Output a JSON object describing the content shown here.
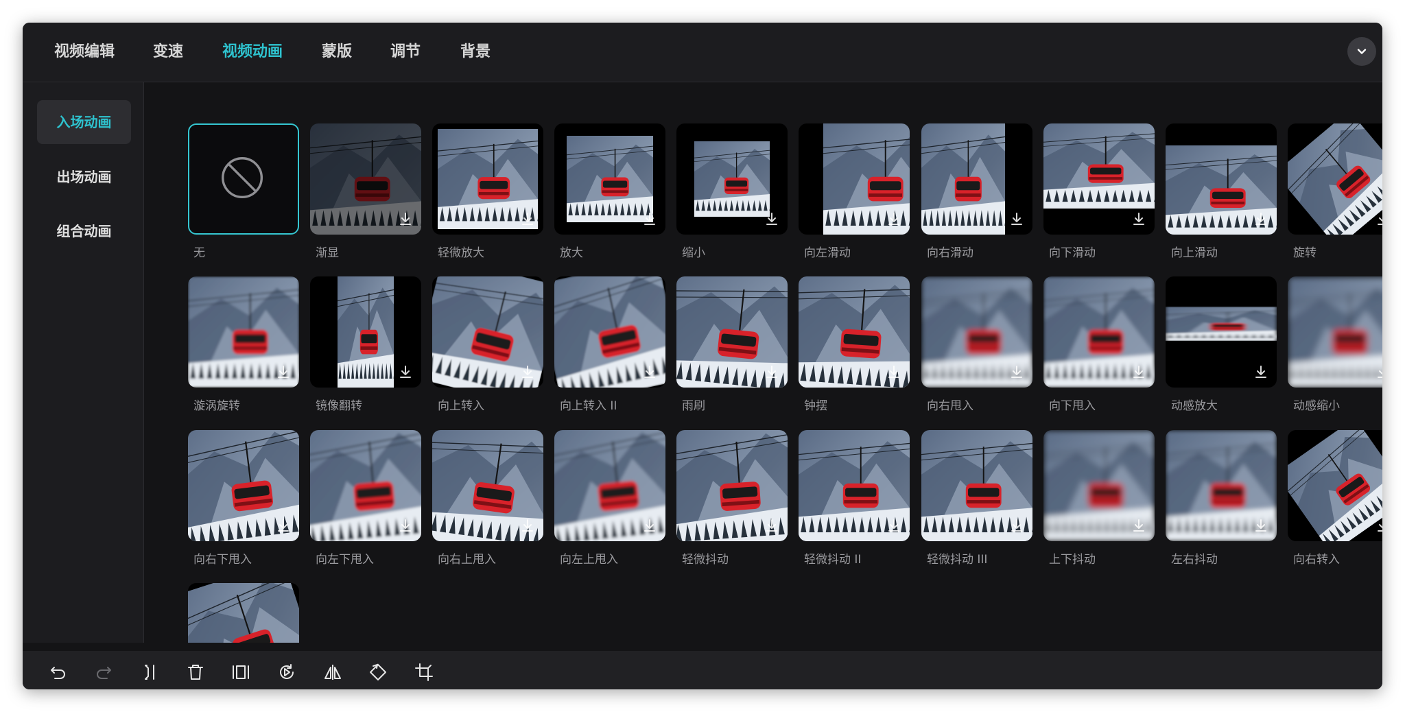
{
  "tabs": [
    {
      "label": "视频编辑",
      "active": false
    },
    {
      "label": "变速",
      "active": false
    },
    {
      "label": "视频动画",
      "active": true
    },
    {
      "label": "蒙版",
      "active": false
    },
    {
      "label": "调节",
      "active": false
    },
    {
      "label": "背景",
      "active": false
    }
  ],
  "sidebar": {
    "items": [
      {
        "label": "入场动画",
        "active": true
      },
      {
        "label": "出场动画",
        "active": false
      },
      {
        "label": "组合动画",
        "active": false
      }
    ]
  },
  "animations": [
    {
      "label": "无",
      "selected": true
    },
    {
      "label": "渐显"
    },
    {
      "label": "轻微放大"
    },
    {
      "label": "放大"
    },
    {
      "label": "缩小"
    },
    {
      "label": "向左滑动"
    },
    {
      "label": "向右滑动"
    },
    {
      "label": "向下滑动"
    },
    {
      "label": "向上滑动"
    },
    {
      "label": "旋转"
    },
    {
      "label": "漩涡旋转"
    },
    {
      "label": "镜像翻转"
    },
    {
      "label": "向上转入"
    },
    {
      "label": "向上转入 II"
    },
    {
      "label": "雨刷"
    },
    {
      "label": "钟摆"
    },
    {
      "label": "向右甩入"
    },
    {
      "label": "向下甩入"
    },
    {
      "label": "动感放大"
    },
    {
      "label": "动感缩小"
    },
    {
      "label": "向右下甩入"
    },
    {
      "label": "向左下甩入"
    },
    {
      "label": "向右上甩入"
    },
    {
      "label": "向左上甩入"
    },
    {
      "label": "轻微抖动"
    },
    {
      "label": "轻微抖动 II"
    },
    {
      "label": "轻微抖动 III"
    },
    {
      "label": "上下抖动"
    },
    {
      "label": "左右抖动"
    },
    {
      "label": "向右转入"
    },
    {
      "label": ""
    }
  ],
  "toolbar": {
    "icons": [
      "undo-icon",
      "redo-icon",
      "split-icon",
      "delete-icon",
      "freeze-frame-icon",
      "reverse-play-icon",
      "mirror-icon",
      "rotate-icon",
      "crop-icon"
    ]
  },
  "colors": {
    "accent": "#2ec3cf",
    "background": "#1b1b1d",
    "gondola": "#d8222a"
  },
  "icons": {
    "none": "no-entry-icon",
    "download": "download-icon",
    "collapse": "chevron-down-icon"
  }
}
